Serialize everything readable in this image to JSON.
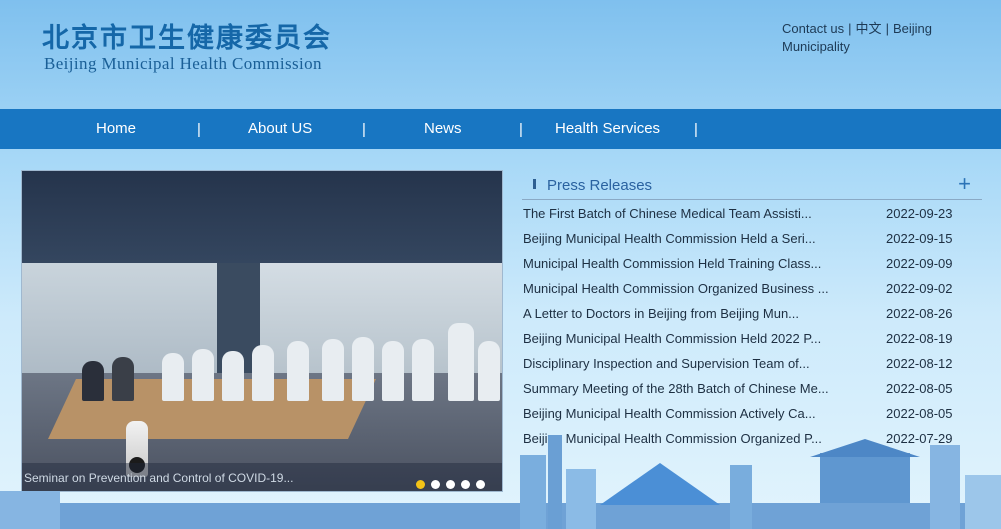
{
  "header": {
    "logo_cn": "北京市卫生健康委员会",
    "logo_en": "Beijing Municipal Health Commission",
    "links": [
      "Contact us",
      "中文",
      "Beijing Municipality"
    ],
    "separator": "|"
  },
  "nav": {
    "items": [
      "Home",
      "About US",
      "News",
      "Health Services"
    ],
    "separator": "|"
  },
  "slideshow": {
    "caption": "Seminar on Prevention and Control of COVID-19...",
    "dot_count": 5,
    "active_dot": 0
  },
  "press": {
    "title": "Press Releases",
    "more_icon": "plus-icon",
    "items": [
      {
        "title": "The First Batch of Chinese Medical Team Assisti...",
        "date": "2022-09-23"
      },
      {
        "title": "Beijing Municipal Health Commission Held a Seri...",
        "date": "2022-09-15"
      },
      {
        "title": "Municipal Health Commission Held Training Class...",
        "date": "2022-09-09"
      },
      {
        "title": "Municipal Health Commission Organized Business ...",
        "date": "2022-09-02"
      },
      {
        "title": "A Letter to Doctors in Beijing from Beijing Mun...",
        "date": "2022-08-26"
      },
      {
        "title": "Beijing Municipal Health Commission Held 2022 P...",
        "date": "2022-08-19"
      },
      {
        "title": "Disciplinary Inspection and Supervision Team of...",
        "date": "2022-08-12"
      },
      {
        "title": "Summary Meeting of the 28th Batch of Chinese Me...",
        "date": "2022-08-05"
      },
      {
        "title": "Beijing Municipal Health Commission Actively Ca...",
        "date": "2022-08-05"
      },
      {
        "title": "Beijing Municipal Health Commission Organized P...",
        "date": "2022-07-29"
      }
    ]
  },
  "colors": {
    "nav_bg": "#1876c2",
    "logo": "#1567a8",
    "active_dot": "#f3c317",
    "skyline": "#5f97d0"
  }
}
